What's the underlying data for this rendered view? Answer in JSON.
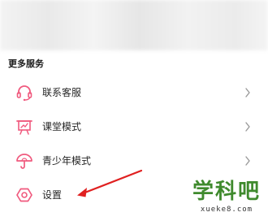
{
  "section": {
    "title": "更多服务"
  },
  "menu": [
    {
      "label": "联系客服",
      "icon": "headset-icon",
      "has_chevron": true
    },
    {
      "label": "课堂模式",
      "icon": "classroom-board-icon",
      "has_chevron": true
    },
    {
      "label": "青少年模式",
      "icon": "umbrella-icon",
      "has_chevron": true
    },
    {
      "label": "设置",
      "icon": "settings-hexagon-icon",
      "has_chevron": false
    }
  ],
  "watermark": {
    "title": "学科吧",
    "url": "xueke8.com"
  },
  "colors": {
    "accent": "#f05a7e",
    "arrow": "#e02020",
    "logo": "#3f8a2d"
  }
}
